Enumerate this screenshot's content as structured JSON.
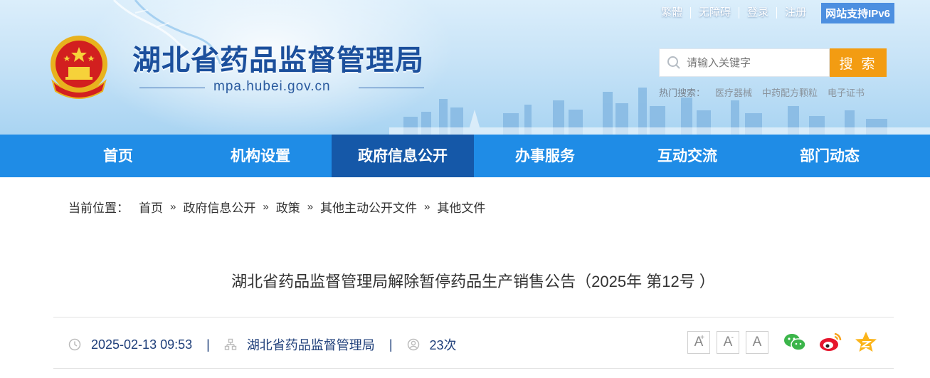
{
  "header": {
    "site_title": "湖北省药品监督管理局",
    "domain": "mpa.hubei.gov.cn",
    "top_links": [
      "繁體",
      "无障碍",
      "登录",
      "注册"
    ],
    "ipv6_badge": "网站支持IPv6",
    "search": {
      "placeholder": "请输入关键字",
      "button": "搜 索"
    },
    "hot_search": {
      "label": "热门搜索：",
      "items": [
        "医疗器械",
        "中药配方颗粒",
        "电子证书"
      ]
    }
  },
  "nav": {
    "items": [
      "首页",
      "机构设置",
      "政府信息公开",
      "办事服务",
      "互动交流",
      "部门动态"
    ],
    "active": "政府信息公开"
  },
  "breadcrumb": {
    "label": "当前位置：",
    "items": [
      "首页",
      "政府信息公开",
      "政策",
      "其他主动公开文件",
      "其他文件"
    ],
    "separator": "»"
  },
  "article": {
    "title": "湖北省药品监督管理局解除暂停药品生产销售公告（2025年 第12号 ）",
    "date": "2025-02-13 09:53",
    "source": "湖北省药品监督管理局",
    "views": "23次",
    "font_sizes": [
      "A",
      "A",
      "A"
    ]
  },
  "colors": {
    "nav_bg": "#1f8ce6",
    "nav_active": "#1558a8",
    "search_button": "#f39c12",
    "title_blue": "#1b4f9c"
  },
  "icons": [
    "clock-icon",
    "org-icon",
    "user-icon",
    "wechat-icon",
    "weibo-icon",
    "qzone-icon",
    "search-icon",
    "national-emblem"
  ]
}
